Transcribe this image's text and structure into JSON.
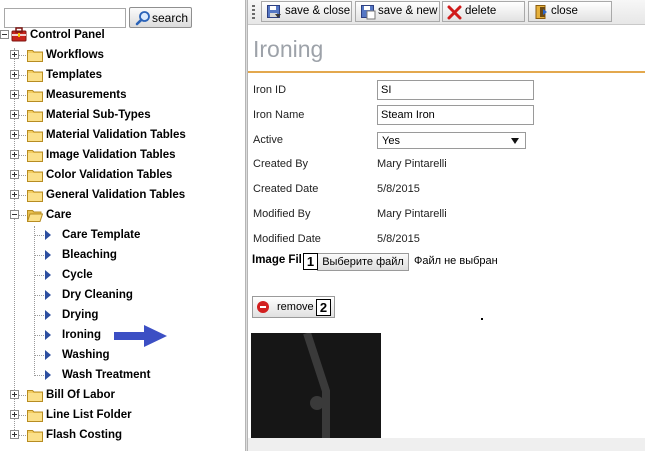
{
  "search": {
    "button_label": "search",
    "value": ""
  },
  "tree": {
    "root": "Control Panel",
    "items": [
      "Workflows",
      "Templates",
      "Measurements",
      "Material Sub-Types",
      "Material Validation Tables",
      "Image Validation Tables",
      "Color Validation Tables",
      "General Validation Tables",
      "Care",
      "Bill Of Labor",
      "Line List Folder",
      "Flash Costing"
    ],
    "care_children": [
      "Care Template",
      "Bleaching",
      "Cycle",
      "Dry Cleaning",
      "Drying",
      "Ironing",
      "Washing",
      "Wash Treatment"
    ]
  },
  "toolbar": {
    "save_close": "save & close",
    "save_new": "save & new",
    "delete": "delete",
    "close": "close"
  },
  "form": {
    "title": "Ironing",
    "iron_id_label": "Iron ID",
    "iron_id_value": "SI",
    "iron_name_label": "Iron Name",
    "iron_name_value": "Steam Iron",
    "active_label": "Active",
    "active_value": "Yes",
    "created_by_label": "Created By",
    "created_by_value": "Mary Pintarelli",
    "created_date_label": "Created Date",
    "created_date_value": "5/8/2015",
    "modified_by_label": "Modified By",
    "modified_by_value": "Mary Pintarelli",
    "modified_date_label": "Modified Date",
    "modified_date_value": "5/8/2015",
    "image_file_label": "Image Fil",
    "file_button_label": "Выберите файл",
    "file_status": "Файл не выбран",
    "remove_label": "remove"
  },
  "callouts": {
    "first": "1",
    "second": "2"
  },
  "colors": {
    "accent_rule": "#e3a84d",
    "title_gray": "#9da2a9",
    "pointer_arrow": "#3c4fc4",
    "leaf_arrow": "#2d4fa0"
  }
}
